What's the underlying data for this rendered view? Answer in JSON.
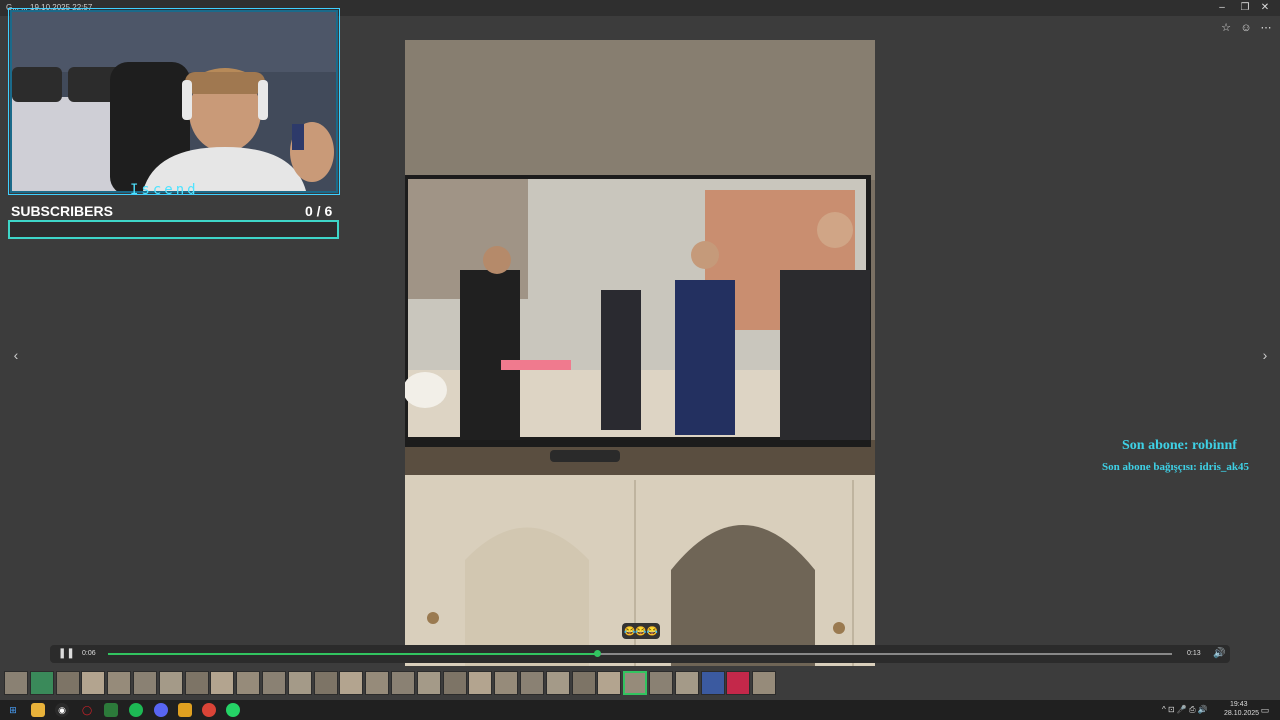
{
  "window": {
    "title": "G...  ... 19.10.2025 22:57",
    "controls": {
      "minimize": "–",
      "restore": "❐",
      "close": "✕"
    },
    "tools": {
      "favorite": "☆",
      "account": "☺",
      "more": "⋯"
    }
  },
  "overlay": {
    "brand_text": "Iscend",
    "subscribers_label": "SUBSCRIBERS",
    "subscribers_count": "0  / 6",
    "subscribers_progress": 0,
    "last_subscriber": "Son abone: robinnf",
    "last_donor": "Son abone bağışçısı: idris_ak45",
    "accent_color": "#3ed1e6"
  },
  "viewer": {
    "prev": "‹",
    "next": "›",
    "reaction": "😂😂😂"
  },
  "player": {
    "pause_icon": "❚❚",
    "current_time": "0:06",
    "total_time": "0:13",
    "progress": 0.46,
    "volume_icon": "🔊",
    "accent_color": "#32c460"
  },
  "filmstrip": {
    "count": 30,
    "active_index": 24
  },
  "taskbar": {
    "icons": [
      "windows-icon",
      "folder-icon",
      "obs-icon",
      "opera-icon",
      "game-icon",
      "spotify-icon",
      "discord-icon",
      "app-icon",
      "chrome-icon",
      "whatsapp-icon"
    ],
    "tray_icons": "^  ⊡  🎤  ⎙  🔊",
    "time": "19:43",
    "date": "28.10.2025"
  }
}
